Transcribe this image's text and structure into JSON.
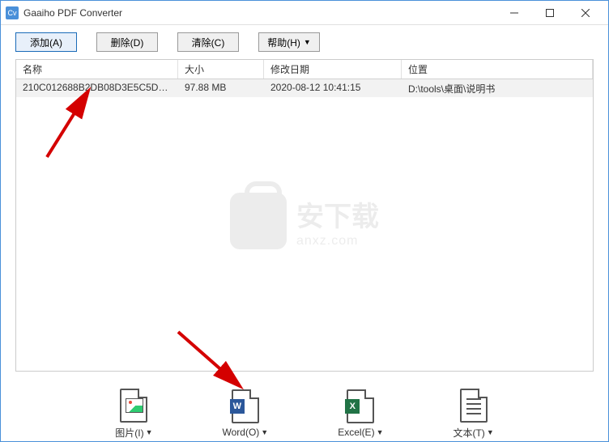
{
  "window": {
    "title": "Gaaiho PDF Converter",
    "icon_label": "Cv"
  },
  "toolbar": {
    "add": "添加(A)",
    "delete": "删除(D)",
    "clear": "清除(C)",
    "help": "帮助(H)"
  },
  "grid": {
    "headers": {
      "name": "名称",
      "size": "大小",
      "date": "修改日期",
      "location": "位置"
    },
    "rows": [
      {
        "name": "210C012688B2DB08D3E5C5D2E...",
        "size": "97.88 MB",
        "date": "2020-08-12 10:41:15",
        "location": "D:\\tools\\桌面\\说明书"
      }
    ]
  },
  "formats": {
    "image": "图片(I)",
    "word": "Word(O)",
    "excel": "Excel(E)",
    "text": "文本(T)"
  },
  "watermark": {
    "title": "安下载",
    "sub": "anxz.com"
  }
}
